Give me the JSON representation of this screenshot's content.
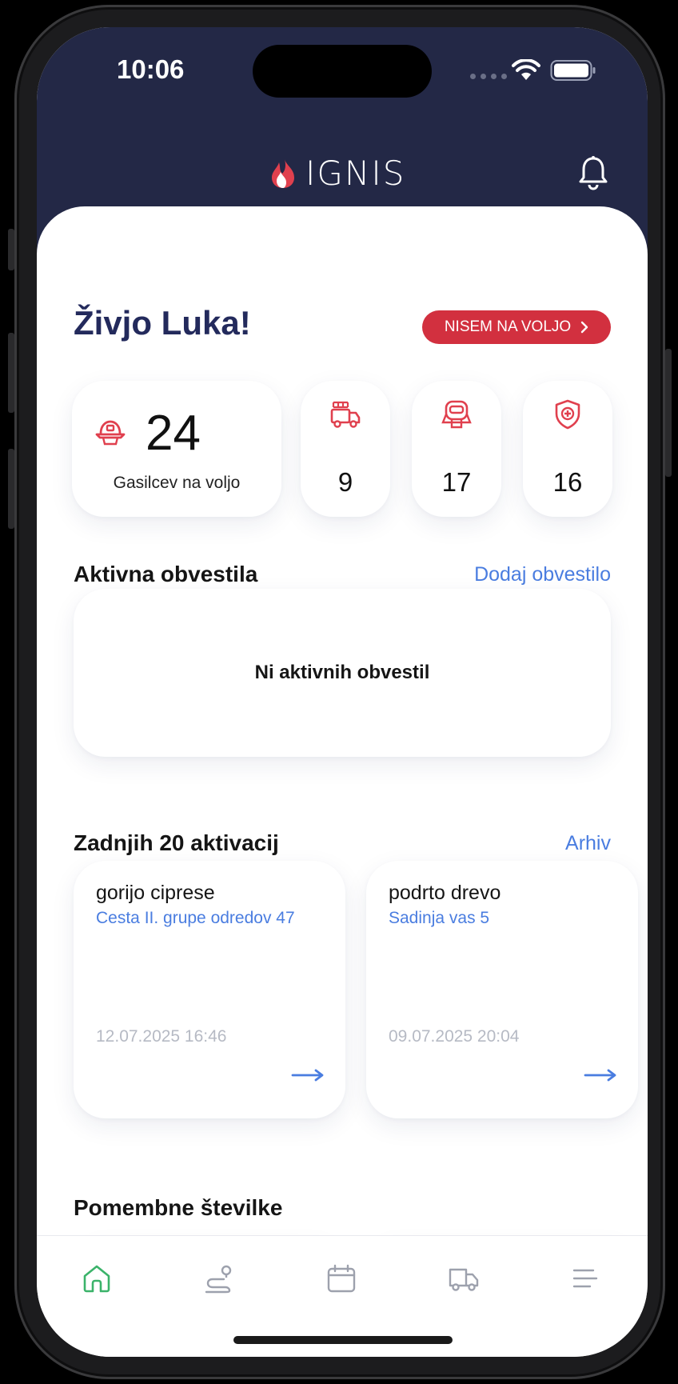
{
  "status": {
    "time": "10:06"
  },
  "header": {
    "brand": "IGNIS"
  },
  "greeting": "Živjo Luka!",
  "availability_button": "NISEM NA VOLJO",
  "stats": {
    "firefighters_available": "24",
    "firefighters_label": "Gasilcev na voljo",
    "vehicles": "9",
    "equipment": "17",
    "medical": "16"
  },
  "notices": {
    "title": "Aktivna obvestila",
    "add_link": "Dodaj obvestilo",
    "empty": "Ni aktivnih obvestil"
  },
  "activations": {
    "title": "Zadnjih 20 aktivacij",
    "archive_link": "Arhiv",
    "items": [
      {
        "title": "gorijo ciprese",
        "address": "Cesta II. grupe odredov 47",
        "date": "12.07.2025 16:46"
      },
      {
        "title": "podrto drevo",
        "address": "Sadinja vas 5",
        "date": "09.07.2025 20:04"
      }
    ]
  },
  "important_numbers": {
    "title": "Pomembne številke"
  },
  "colors": {
    "header": "#232846",
    "accent": "#d2303f",
    "link": "#4a7de0",
    "active_tab": "#3bb36a"
  },
  "tabs": [
    "home-icon",
    "route-icon",
    "calendar-icon",
    "truck-icon",
    "menu-icon"
  ]
}
